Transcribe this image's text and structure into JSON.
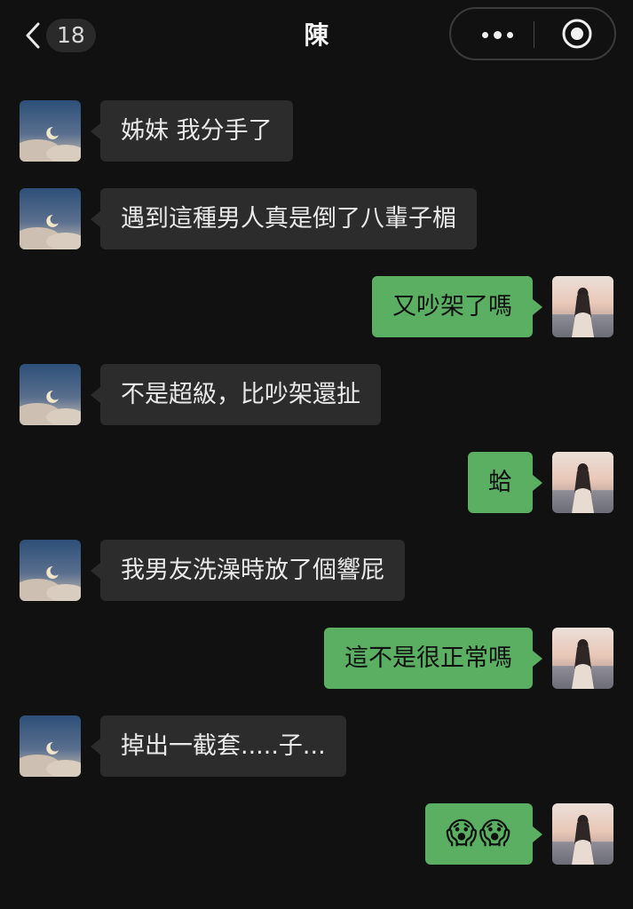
{
  "header": {
    "back_icon": "chevron-left-icon",
    "unread_count": "18",
    "title": "陳",
    "more_icon": "more-dots-icon",
    "close_icon": "target-close-icon"
  },
  "colors": {
    "background": "#111111",
    "incoming_bubble": "#2c2c2c",
    "outgoing_bubble": "#5aaf63"
  },
  "messages": [
    {
      "side": "left",
      "text": "姊妹 我分手了"
    },
    {
      "side": "left",
      "text": "遇到這種男人真是倒了八輩子楣"
    },
    {
      "side": "right",
      "text": "又吵架了嗎"
    },
    {
      "side": "left",
      "text": "不是超級，比吵架還扯"
    },
    {
      "side": "right",
      "text": "蛤"
    },
    {
      "side": "left",
      "text": "我男友洗澡時放了個響屁"
    },
    {
      "side": "right",
      "text": "這不是很正常嗎"
    },
    {
      "side": "left",
      "text": "掉出一截套.....子..."
    },
    {
      "side": "right",
      "text": "😱😱"
    }
  ]
}
